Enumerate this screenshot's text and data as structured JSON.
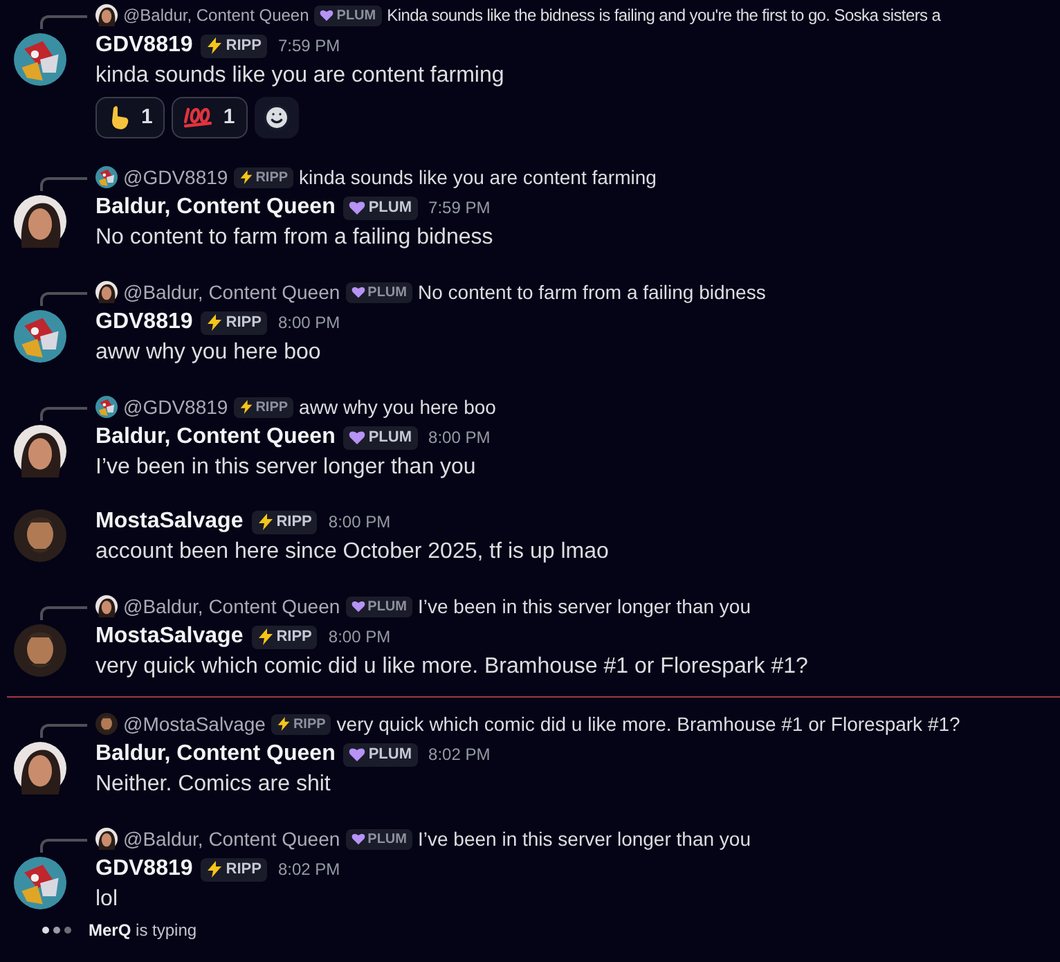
{
  "messages": [
    {
      "author": "GDV8819",
      "avatar": {
        "kind": "robot"
      },
      "badge": {
        "kind": "ripp",
        "label": "RIPP"
      },
      "time": "7:59 PM",
      "text": "kinda sounds like you are content farming",
      "divider_above": false,
      "reply": {
        "author": "@Baldur, Content Queen",
        "avatar": {
          "kind": "woman"
        },
        "badge": {
          "kind": "plum",
          "label": "PLUM"
        },
        "text": "Kinda sounds like the bidness is failing and you're the first to go. Soska sisters a"
      },
      "reactions": [
        {
          "kind": "pointing",
          "count": "1"
        },
        {
          "kind": "hundred",
          "count": "1"
        }
      ]
    },
    {
      "author": "Baldur, Content Queen",
      "avatar": {
        "kind": "woman"
      },
      "badge": {
        "kind": "plum",
        "label": "PLUM"
      },
      "time": "7:59 PM",
      "text": "No content to farm from a failing bidness",
      "divider_above": false,
      "reply": {
        "author": "@GDV8819",
        "avatar": {
          "kind": "robot"
        },
        "badge": {
          "kind": "ripp",
          "label": "RIPP"
        },
        "text": "kinda sounds like you are content farming"
      }
    },
    {
      "author": "GDV8819",
      "avatar": {
        "kind": "robot"
      },
      "badge": {
        "kind": "ripp",
        "label": "RIPP"
      },
      "time": "8:00 PM",
      "text": "aww why you here boo",
      "divider_above": false,
      "reply": {
        "author": "@Baldur, Content Queen",
        "avatar": {
          "kind": "woman"
        },
        "badge": {
          "kind": "plum",
          "label": "PLUM"
        },
        "text": "No content to farm from a failing bidness"
      }
    },
    {
      "author": "Baldur, Content Queen",
      "avatar": {
        "kind": "woman"
      },
      "badge": {
        "kind": "plum",
        "label": "PLUM"
      },
      "time": "8:00 PM",
      "text": "I’ve been in this server longer than you",
      "divider_above": false,
      "reply": {
        "author": "@GDV8819",
        "avatar": {
          "kind": "robot"
        },
        "badge": {
          "kind": "ripp",
          "label": "RIPP"
        },
        "text": "aww why you here boo"
      }
    },
    {
      "author": "MostaSalvage",
      "avatar": {
        "kind": "man"
      },
      "badge": {
        "kind": "ripp",
        "label": "RIPP"
      },
      "time": "8:00 PM",
      "text": "account been here since October 2025, tf is up lmao",
      "divider_above": false
    },
    {
      "author": "MostaSalvage",
      "avatar": {
        "kind": "man"
      },
      "badge": {
        "kind": "ripp",
        "label": "RIPP"
      },
      "time": "8:00 PM",
      "text": "very quick which comic did u like more. Bramhouse #1 or Florespark #1?",
      "divider_above": false,
      "reply": {
        "author": "@Baldur, Content Queen",
        "avatar": {
          "kind": "woman"
        },
        "badge": {
          "kind": "plum",
          "label": "PLUM"
        },
        "text": "I’ve been in this server longer than you"
      }
    },
    {
      "author": "Baldur, Content Queen",
      "avatar": {
        "kind": "woman"
      },
      "badge": {
        "kind": "plum",
        "label": "PLUM"
      },
      "time": "8:02 PM",
      "text": "Neither. Comics are shit",
      "divider_above": true,
      "reply": {
        "author": "@MostaSalvage",
        "avatar": {
          "kind": "man"
        },
        "badge": {
          "kind": "ripp",
          "label": "RIPP"
        },
        "text": "very quick which comic did u like more. Bramhouse #1 or Florespark #1?"
      }
    },
    {
      "author": "GDV8819",
      "avatar": {
        "kind": "robot"
      },
      "badge": {
        "kind": "ripp",
        "label": "RIPP"
      },
      "time": "8:02 PM",
      "text": "lol",
      "divider_above": false,
      "reply": {
        "author": "@Baldur, Content Queen",
        "avatar": {
          "kind": "woman"
        },
        "badge": {
          "kind": "plum",
          "label": "PLUM"
        },
        "text": "I’ve been in this server longer than you"
      }
    }
  ],
  "typing": {
    "user": "MerQ",
    "text": "is typing"
  }
}
